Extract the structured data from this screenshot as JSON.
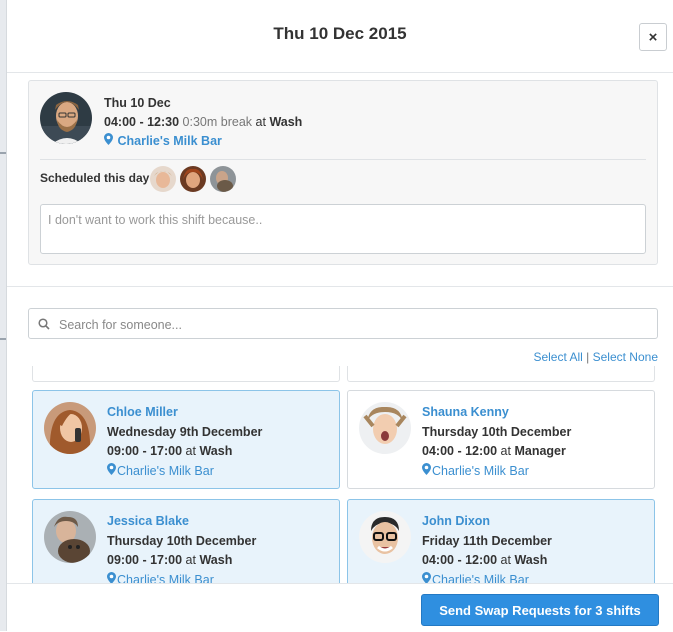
{
  "modal": {
    "title": "Thu 10 Dec 2015",
    "close_label": "×"
  },
  "shift": {
    "date": "Thu 10 Dec",
    "time": "04:00 - 12:30",
    "break": "0:30m break",
    "at_word": "at",
    "role": "Wash",
    "location": "Charlie's Milk Bar",
    "scheduled_label": "Scheduled this day:",
    "reason_placeholder": "I don't want to work this shift because.."
  },
  "search": {
    "placeholder": "Search for someone...",
    "select_all": "Select All",
    "separator": "|",
    "select_none": "Select None"
  },
  "people": [
    {
      "name": "Chloe Miller",
      "date": "Wednesday 9th December",
      "time": "09:00 - 17:00",
      "at_word": "at",
      "role": "Wash",
      "location": "Charlie's Milk Bar",
      "selected": true
    },
    {
      "name": "Shauna Kenny",
      "date": "Thursday 10th December",
      "time": "04:00 - 12:00",
      "at_word": "at",
      "role": "Manager",
      "location": "Charlie's Milk Bar",
      "selected": false
    },
    {
      "name": "Jessica Blake",
      "date": "Thursday 10th December",
      "time": "09:00 - 17:00",
      "at_word": "at",
      "role": "Wash",
      "location": "Charlie's Milk Bar",
      "selected": true
    },
    {
      "name": "John Dixon",
      "date": "Friday 11th December",
      "time": "04:00 - 12:00",
      "at_word": "at",
      "role": "Wash",
      "location": "Charlie's Milk Bar",
      "selected": true
    }
  ],
  "footer": {
    "send_label": "Send Swap Requests for 3 shifts"
  },
  "colors": {
    "accent": "#3b8fd0",
    "button": "#2f8fe0",
    "selected_bg": "#e8f3fb"
  },
  "icons": {
    "pin": "map-pin-icon",
    "search": "search-icon",
    "close": "close-icon"
  }
}
